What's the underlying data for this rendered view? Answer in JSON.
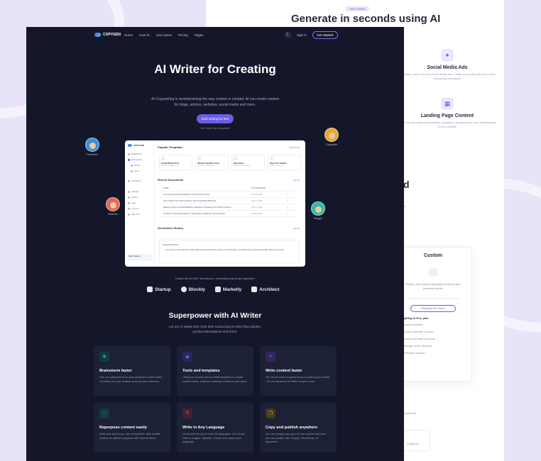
{
  "back_page": {
    "badge": "USE CASES",
    "title": "Generate in seconds using AI",
    "card1_title": "Social Media Ads",
    "card1_desc": "Generate copies for your social media ads - make an impact with your online marketing campaigns",
    "card2_title": "Landing Page Content",
    "card2_desc": "Write any eye-catching headlines, slogans or paragraph for your landing page of your website.",
    "fragment_heading": "d",
    "fragment_text": "ur",
    "pricing_title": "Custom",
    "pricing_desc": "Design your custom package for teams and business needs",
    "pricing_button": "Request the Demo",
    "pricing_list_head": "Everything in Pro, plus",
    "pricing_features": [
      "Custom pricing",
      "Custom number of uses",
      "Custom number of words",
      "Manage team member",
      "Premium support"
    ],
    "contact_text": "contact us",
    "box_label": "CopyGen"
  },
  "nav": {
    "brand": "COPYGEN",
    "links": [
      "Home",
      "How To",
      "Use Cases",
      "Pricing",
      "Pages"
    ],
    "theme_icon": "moon-icon",
    "signin": "Sign in",
    "cta": "Get Started"
  },
  "hero": {
    "title": "AI Writer for Creating",
    "desc": "AI Copywriting is revolutionizing the way content is created. AI can create content for blogs, articles, websites, social media and more.",
    "button": "Start writing for free",
    "note": "No credit card required"
  },
  "avatars": [
    {
      "label": "Freelancer",
      "color": "#3f8fdc"
    },
    {
      "label": "Copywriter",
      "color": "#e7a536"
    },
    {
      "label": "Marketer",
      "color": "#e2675a"
    },
    {
      "label": "Blogger",
      "color": "#36b9a8"
    }
  ],
  "dashboard": {
    "brand": "COPYGEN",
    "sidebar": [
      "Dashboard",
      "Documents",
      "Drafts",
      "Docs",
      "Templates",
      "Settings",
      "Profile",
      "Help",
      "Account",
      "Sign Out"
    ],
    "user": "Abriel Stephen",
    "popular_title": "Popular Templates",
    "popular_link": "Explore All",
    "templates": [
      {
        "title": "Social Media Posts",
        "desc": "Generate engaging posts"
      },
      {
        "title": "Website Headline Copy",
        "desc": "Catchy website headlines"
      },
      {
        "title": "Blog Ideas",
        "desc": "Ideas for your next blog"
      },
      {
        "title": "Blog Post Outline",
        "desc": "Outline for blog posts"
      }
    ],
    "recent_title": "Recent Documents",
    "recent_link": "See All",
    "table_head": [
      "NAME",
      "LAST MODIFIED"
    ],
    "rows": [
      {
        "name": "The Impact of Artificial Intelligence on the Future of Work",
        "date": "Feb 15, 2023"
      },
      {
        "name": "How to Boost Your Online Presence with Social Media Marketing",
        "date": "Feb 12, 2023"
      },
      {
        "name": "Mastering the Art of Email Marketing: Strategies for Boosting Your Online Presence",
        "date": "Feb 10, 2023"
      },
      {
        "name": "The Rise of Sustainable Fashion: Opportunities, Challenges, and Innovation",
        "date": "Feb 05, 2023"
      }
    ],
    "gen_title": "Generation History",
    "gen_link": "See All",
    "gen_question": "Social Media Post",
    "gen_answer": "If you want a more balanced, rhythmically intense post that will inspire you to take action, you should get your dream job today. Start your journey!"
  },
  "trusted": "Trusted by 40,000+ freelancers, marketing teams and agencies.",
  "brands": [
    "Startup",
    "Blockly",
    "Marketly",
    "Architect"
  ],
  "superpower": {
    "title": "Superpower with AI Writer",
    "desc": "Let our AI assist with most time consuming to write blog articles, product descriptions and more."
  },
  "features": [
    {
      "title": "Brainstorm faster",
      "desc": "Use our advanced AI as your personal content writer or partner for your endless work for your business.",
      "icon": "lightbulb-icon",
      "color": "#1ea7a0"
    },
    {
      "title": "Tools and templates",
      "desc": "Using our AI tools and pre-built templates to create content briefs, write and optimize content in one place.",
      "icon": "grid-icon",
      "color": "#6b5ce7"
    },
    {
      "title": "Write content faster",
      "desc": "You do not need to spend hours to write good content - let our advanced AI Writer to get it done.",
      "icon": "bolt-icon",
      "color": "#7b4fe0"
    },
    {
      "title": "Repurpose content easily",
      "desc": "Write and send once, use everywhere. Also rewrite content for different purpose with minimal effort.",
      "icon": "recycle-icon",
      "color": "#1ea7a0"
    },
    {
      "title": "Write in Any Language",
      "desc": "Let AI write for you in over 40 languages. Our AI can write in English, Spanish, French and many more language.",
      "icon": "text-icon",
      "color": "#d94e5a"
    },
    {
      "title": "Copy and publish anywhere",
      "desc": "You can simply copy your AI new content and from you can publish, like Shopify, WordPress, or anywhere.",
      "icon": "copy-icon",
      "color": "#d9a238"
    }
  ]
}
